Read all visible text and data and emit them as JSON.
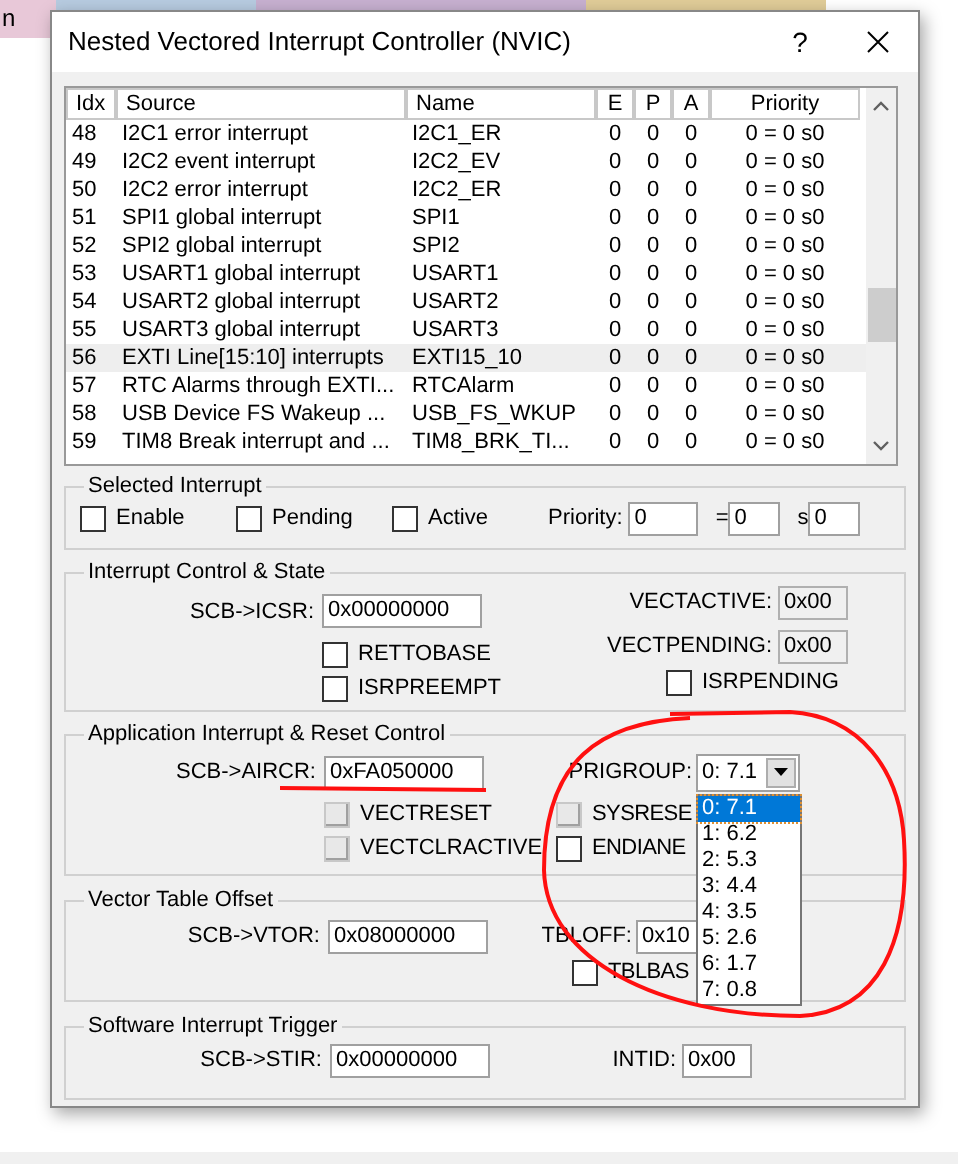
{
  "background_window": {
    "text": "n"
  },
  "dialog": {
    "title": "Nested Vectored Interrupt Controller (NVIC)",
    "help_button": "?"
  },
  "interrupt_table": {
    "columns": [
      "Idx",
      "Source",
      "Name",
      "E",
      "P",
      "A",
      "Priority"
    ],
    "rows": [
      {
        "idx": "48",
        "source": "I2C1 error interrupt",
        "name": "I2C1_ER",
        "e": "0",
        "p": "0",
        "a": "0",
        "priority": "0 = 0 s0",
        "selected": false
      },
      {
        "idx": "49",
        "source": "I2C2 event interrupt",
        "name": "I2C2_EV",
        "e": "0",
        "p": "0",
        "a": "0",
        "priority": "0 = 0 s0",
        "selected": false
      },
      {
        "idx": "50",
        "source": "I2C2 error interrupt",
        "name": "I2C2_ER",
        "e": "0",
        "p": "0",
        "a": "0",
        "priority": "0 = 0 s0",
        "selected": false
      },
      {
        "idx": "51",
        "source": "SPI1 global interrupt",
        "name": "SPI1",
        "e": "0",
        "p": "0",
        "a": "0",
        "priority": "0 = 0 s0",
        "selected": false
      },
      {
        "idx": "52",
        "source": "SPI2 global interrupt",
        "name": "SPI2",
        "e": "0",
        "p": "0",
        "a": "0",
        "priority": "0 = 0 s0",
        "selected": false
      },
      {
        "idx": "53",
        "source": "USART1 global interrupt",
        "name": "USART1",
        "e": "0",
        "p": "0",
        "a": "0",
        "priority": "0 = 0 s0",
        "selected": false
      },
      {
        "idx": "54",
        "source": "USART2 global interrupt",
        "name": "USART2",
        "e": "0",
        "p": "0",
        "a": "0",
        "priority": "0 = 0 s0",
        "selected": false
      },
      {
        "idx": "55",
        "source": "USART3 global interrupt",
        "name": "USART3",
        "e": "0",
        "p": "0",
        "a": "0",
        "priority": "0 = 0 s0",
        "selected": false
      },
      {
        "idx": "56",
        "source": "EXTI Line[15:10] interrupts",
        "name": "EXTI15_10",
        "e": "0",
        "p": "0",
        "a": "0",
        "priority": "0 = 0 s0",
        "selected": true
      },
      {
        "idx": "57",
        "source": "RTC Alarms through EXTI...",
        "name": "RTCAlarm",
        "e": "0",
        "p": "0",
        "a": "0",
        "priority": "0 = 0 s0",
        "selected": false
      },
      {
        "idx": "58",
        "source": "USB Device FS Wakeup ...",
        "name": "USB_FS_WKUP",
        "e": "0",
        "p": "0",
        "a": "0",
        "priority": "0 = 0 s0",
        "selected": false
      },
      {
        "idx": "59",
        "source": "TIM8 Break interrupt and ...",
        "name": "TIM8_BRK_TI...",
        "e": "0",
        "p": "0",
        "a": "0",
        "priority": "0 = 0 s0",
        "selected": false
      }
    ]
  },
  "selected_interrupt": {
    "title": "Selected Interrupt",
    "checkboxes": [
      {
        "label": "Enable",
        "checked": false
      },
      {
        "label": "Pending",
        "checked": false
      },
      {
        "label": "Active",
        "checked": false
      }
    ],
    "priority_label": "Priority:",
    "priority": "0",
    "equals": "=",
    "group": "0",
    "sub_label": "s",
    "sub": "0"
  },
  "interrupt_control": {
    "title": "Interrupt Control & State",
    "icsr_label": "SCB->ICSR:",
    "icsr": "0x00000000",
    "vectactive_label": "VECTACTIVE:",
    "vectactive": "0x00",
    "vectpending_label": "VECTPENDING:",
    "vectpending": "0x00",
    "checkboxes": [
      {
        "label": "RETTOBASE",
        "checked": false
      },
      {
        "label": "ISRPREEMPT",
        "checked": false
      },
      {
        "label": "ISRPENDING",
        "checked": false
      }
    ]
  },
  "app_interrupt": {
    "title": "Application Interrupt & Reset Control",
    "aircr_label": "SCB->AIRCR:",
    "aircr": "0xFA050000",
    "prigroup_label": "PRIGROUP:",
    "prigroup": "0: 7.1",
    "expanded": true,
    "checkboxes": [
      {
        "label": "VECTRESET",
        "checked": false,
        "disabled": true
      },
      {
        "label": "SYSRESE",
        "checked": false,
        "disabled": true
      },
      {
        "label": "VECTCLRACTIVE",
        "checked": false,
        "disabled": true
      },
      {
        "label": "ENDIANE",
        "checked": false,
        "disabled": false
      }
    ],
    "options": [
      {
        "label": "0: 7.1",
        "selected": true
      },
      {
        "label": "1: 6.2",
        "selected": false
      },
      {
        "label": "2: 5.3",
        "selected": false
      },
      {
        "label": "3: 4.4",
        "selected": false
      },
      {
        "label": "4: 3.5",
        "selected": false
      },
      {
        "label": "5: 2.6",
        "selected": false
      },
      {
        "label": "6: 1.7",
        "selected": false
      },
      {
        "label": "7: 0.8",
        "selected": false
      }
    ]
  },
  "vector_table": {
    "title": "Vector Table Offset",
    "vtor_label": "SCB->VTOR:",
    "vtor": "0x08000000",
    "tbloff_label": "TBLOFF:",
    "tbloff": "0x10",
    "tblbase_label": "TBLBAS",
    "tblbase_checked": false
  },
  "software_trigger": {
    "title": "Software Interrupt Trigger",
    "stir_label": "SCB->STIR:",
    "stir": "0x00000000",
    "intid_label": "INTID:",
    "intid": "0x00"
  },
  "annotations": {
    "aircr_underline": true,
    "prigroup_circle": true
  }
}
